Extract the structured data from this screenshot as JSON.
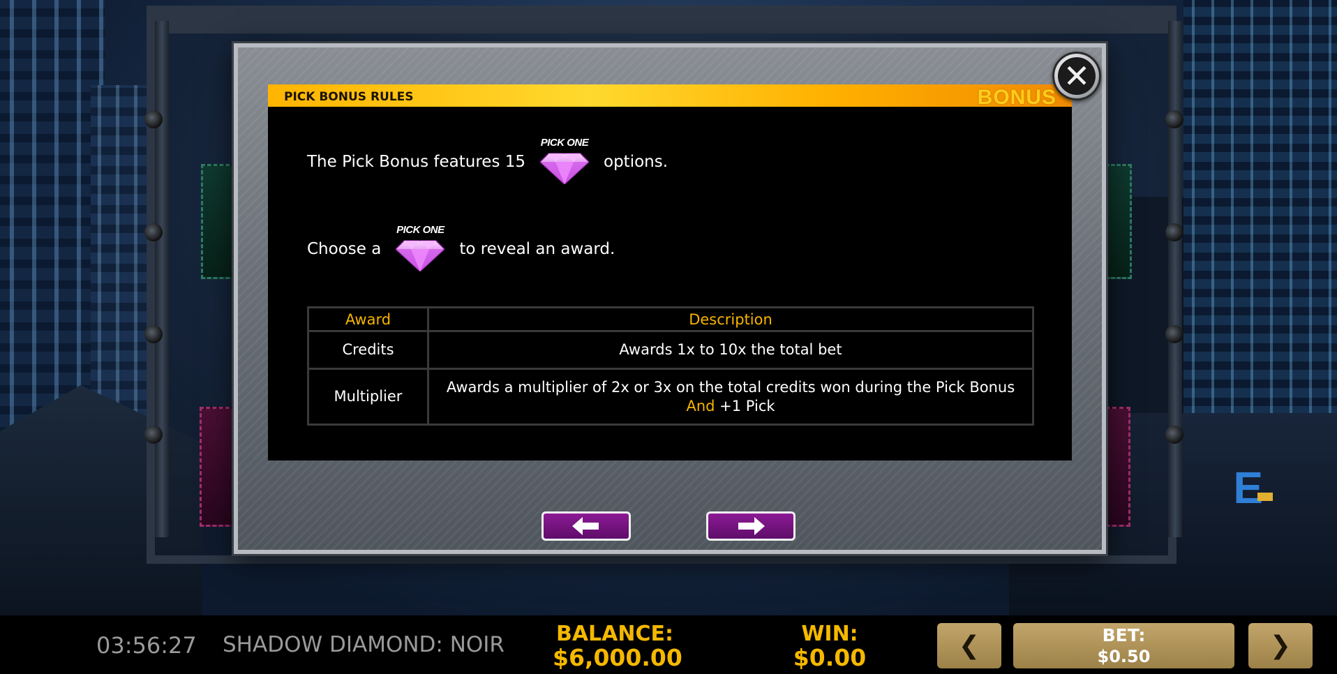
{
  "modal": {
    "header_title": "PICK BONUS RULES",
    "header_badge": "BONUS",
    "close_glyph": "✕",
    "line1_before": "The Pick Bonus features 15",
    "line1_after": "options.",
    "line2_before": "Choose a",
    "line2_after": "to reveal an award.",
    "gem_label": "PICK ONE",
    "gem_icon": "pink-diamond-icon",
    "table": {
      "headers": [
        "Award",
        "Description"
      ],
      "rows": [
        {
          "award": "Credits",
          "description": "Awards 1x to 10x the total bet"
        },
        {
          "award": "Multiplier",
          "description_a": "Awards a multiplier of 2x or 3x on the total credits won during the Pick Bonus",
          "description_and": "And",
          "description_b": "+1 Pick"
        }
      ]
    },
    "nav": {
      "prev_icon": "arrow-left-icon",
      "next_icon": "arrow-right-icon"
    }
  },
  "status_bar": {
    "clock": "03:56:27",
    "game_title": "SHADOW DIAMOND: NOIR",
    "balance_label": "BALANCE:",
    "balance_value": "$6,000.00",
    "win_label": "WIN:",
    "win_value": "$0.00",
    "bet_label": "BET:",
    "bet_value": "$0.50",
    "bet_decrease_glyph": "❮",
    "bet_increase_glyph": "❯"
  },
  "colors": {
    "accent_gold": "#f7b400",
    "header_orange": "#ffb400",
    "nav_purple": "#8c1a95",
    "gem_pink": "#e67cf5"
  }
}
